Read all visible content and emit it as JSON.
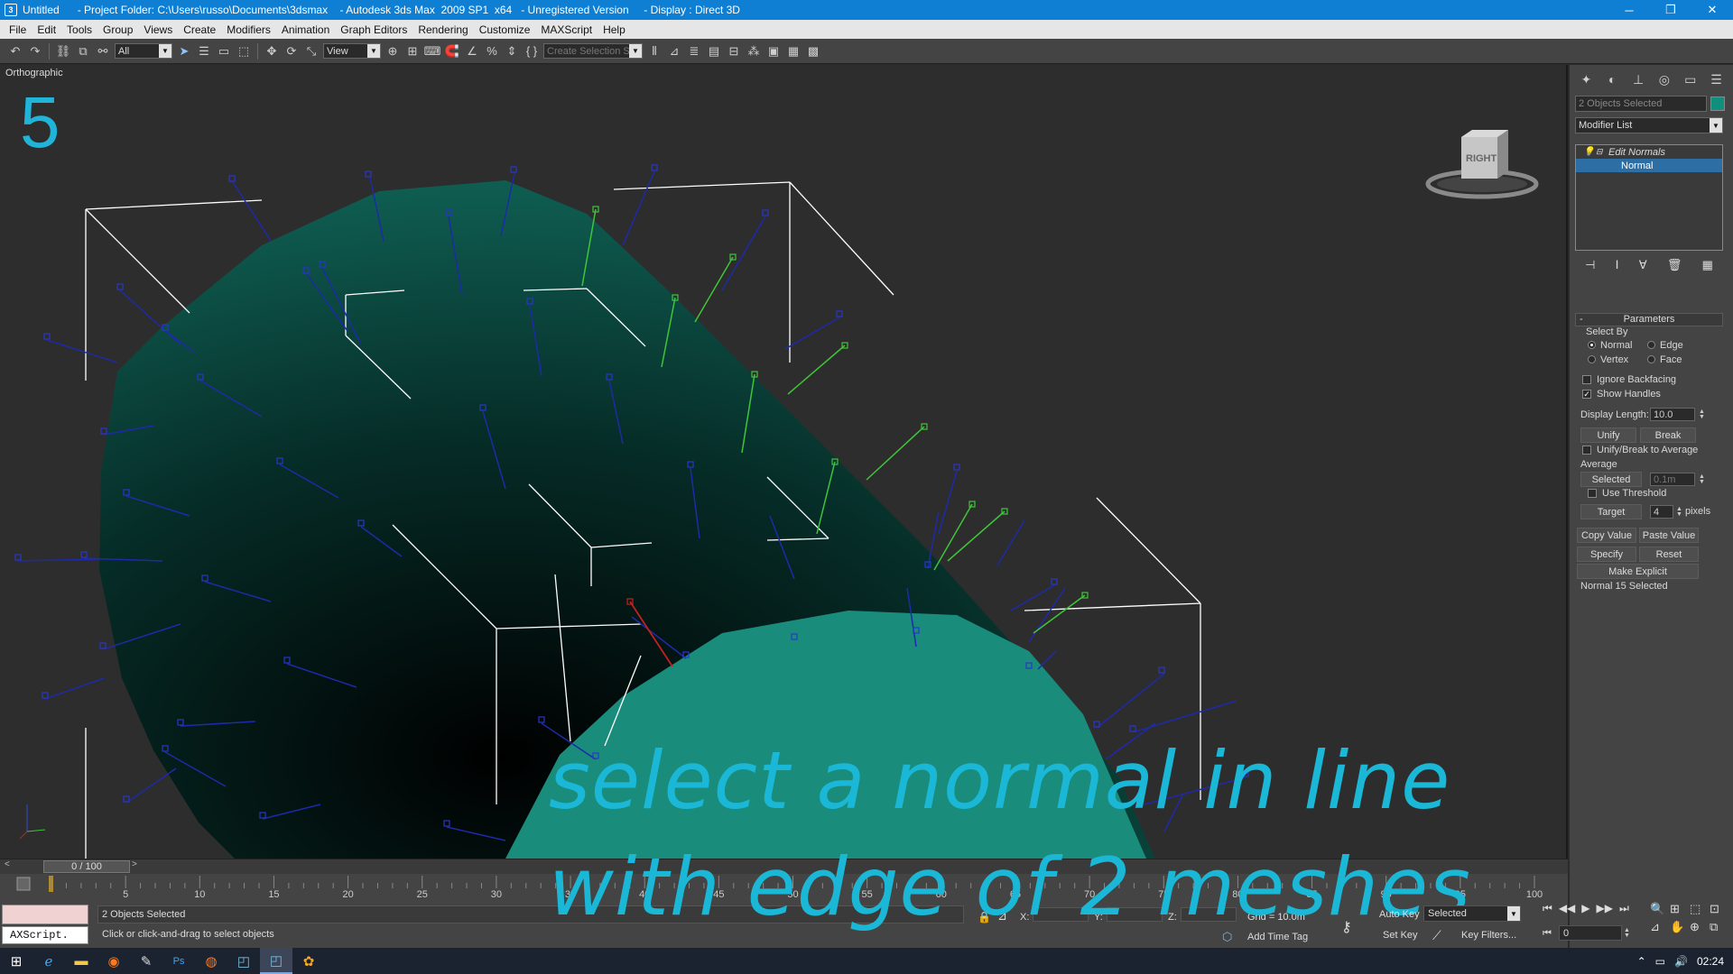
{
  "titlebar": {
    "title": "Untitled      - Project Folder: C:\\Users\\russo\\Documents\\3dsmax    - Autodesk 3ds Max  2009 SP1  x64   - Unregistered Version     - Display : Direct 3D",
    "minimize": "─",
    "restore": "❐",
    "close": "✕"
  },
  "menubar": [
    "File",
    "Edit",
    "Tools",
    "Group",
    "Views",
    "Create",
    "Modifiers",
    "Animation",
    "Graph Editors",
    "Rendering",
    "Customize",
    "MAXScript",
    "Help"
  ],
  "toolbar": {
    "selection_filter": "All",
    "reference_coord": "View",
    "named_selection_placeholder": "Create Selection Se"
  },
  "viewport": {
    "label": "Orthographic",
    "step_number": "5",
    "caption_line1": "select a normal in line",
    "caption_line2": "with edge of 2 meshes",
    "viewcube_face": "RIGHT",
    "colors": {
      "mesh_dark": "#0f5e52",
      "mesh_light": "#1a8c7c",
      "normal_blue": "#1e2aa8",
      "normal_green": "#3fc43a",
      "normal_selected": "#c42020",
      "bbox_white": "#ffffff"
    }
  },
  "command_panel": {
    "selection_field": "2 Objects Selected",
    "modifier_list": "Modifier List",
    "stack": {
      "modifier": "Edit Normals",
      "subobject": "Normal"
    },
    "parameters_title": "Parameters",
    "select_by_label": "Select By",
    "select_by": [
      {
        "label": "Normal",
        "checked": true
      },
      {
        "label": "Edge",
        "checked": false
      },
      {
        "label": "Vertex",
        "checked": false
      },
      {
        "label": "Face",
        "checked": false
      }
    ],
    "ignore_backfacing": "Ignore Backfacing",
    "show_handles": "Show Handles",
    "display_length_label": "Display Length:",
    "display_length_value": "10.0",
    "unify": "Unify",
    "break": "Break",
    "unify_break_avg": "Unify/Break to Average",
    "average_label": "Average",
    "selected_btn": "Selected",
    "selected_value": "0.1m",
    "use_threshold": "Use Threshold",
    "target_btn": "Target",
    "target_value": "4",
    "pixels": "pixels",
    "copy_value": "Copy Value",
    "paste_value": "Paste Value",
    "specify": "Specify",
    "reset": "Reset",
    "make_explicit": "Make Explicit",
    "status": "Normal 15 Selected"
  },
  "timeline": {
    "frame_display": "0 / 100",
    "ticks": [
      "5",
      "10",
      "15",
      "20",
      "25",
      "30",
      "35",
      "40",
      "45",
      "50",
      "55",
      "60",
      "65",
      "70",
      "75",
      "80",
      "85",
      "90",
      "95",
      "100"
    ]
  },
  "status": {
    "selection": "2 Objects Selected",
    "prompt": "Click or click-and-drag to select objects",
    "x_label": "X:",
    "y_label": "Y:",
    "z_label": "Z:",
    "grid": "Grid = 10.0m",
    "add_time_tag": "Add Time Tag",
    "maxscript": "AXScript."
  },
  "anim": {
    "auto_key": "Auto Key",
    "set_key": "Set Key",
    "selected_dd": "Selected",
    "key_filters": "Key Filters...",
    "frame": "0"
  },
  "taskbar": {
    "clock": "02:24"
  }
}
